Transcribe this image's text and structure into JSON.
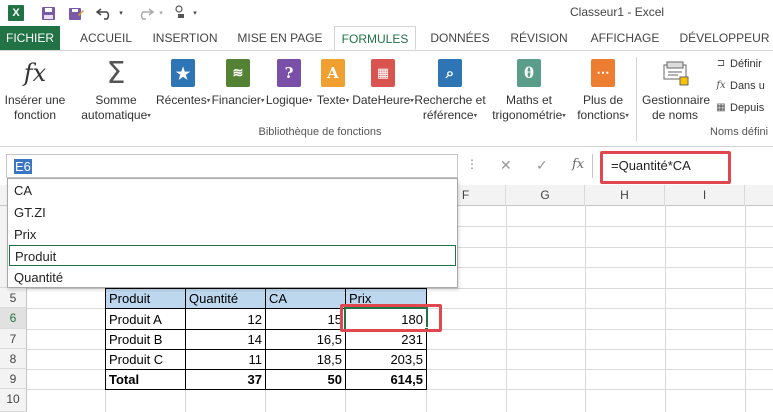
{
  "window": {
    "title": "Classeur1 - Excel"
  },
  "quick_access": {
    "logo_letter": "X"
  },
  "tabs": [
    "FICHIER",
    "ACCUEIL",
    "INSERTION",
    "MISE EN PAGE",
    "FORMULES",
    "DONNÉES",
    "RÉVISION",
    "AFFICHAGE",
    "DÉVELOPPEUR"
  ],
  "active_tab": "FORMULES",
  "ribbon": {
    "insert_function": {
      "line1": "Insérer une",
      "line2": "fonction",
      "icon_text": "fx"
    },
    "autosum": {
      "line1": "Somme",
      "line2": "automatique"
    },
    "recent": {
      "label": "Récentes"
    },
    "financial": {
      "label": "Financier"
    },
    "logical": {
      "label": "Logique",
      "icon_text": "?"
    },
    "text": {
      "label": "Texte",
      "icon_text": "A"
    },
    "datetime": {
      "label": "DateHeure"
    },
    "lookup": {
      "line1": "Recherche et",
      "line2": "référence"
    },
    "math": {
      "line1": "Maths et",
      "line2": "trigonométrie",
      "icon_text": "θ"
    },
    "more": {
      "line1": "Plus de",
      "line2": "fonctions"
    },
    "group_label": "Bibliothèque de fonctions",
    "name_manager": {
      "line1": "Gestionnaire",
      "line2": "de noms"
    },
    "define_name": "Définir",
    "use_in_formula": "Dans u",
    "create_from_selection": "Depuis",
    "group2_label": "Noms défini"
  },
  "formula_bar": {
    "name_box_value": "E6",
    "formula": "=Quantité*CA",
    "fx": "fx"
  },
  "name_dropdown": {
    "items": [
      "CA",
      "GT.ZI",
      "Prix",
      "Produit",
      "Quantité"
    ],
    "selected": "Produit"
  },
  "grid": {
    "column_headers": [
      "F",
      "G",
      "H",
      "I"
    ],
    "row_headers": [
      "5",
      "6",
      "7",
      "8",
      "9",
      "10"
    ],
    "selected_row": "6",
    "table": {
      "headers": [
        "Produit",
        "Quantité",
        "CA",
        "Prix"
      ],
      "rows": [
        [
          "Produit A",
          "12",
          "15",
          "180"
        ],
        [
          "Produit B",
          "14",
          "16,5",
          "231"
        ],
        [
          "Produit C",
          "11",
          "18,5",
          "203,5"
        ]
      ],
      "total": [
        "Total",
        "37",
        "50",
        "614,5"
      ]
    }
  },
  "colors": {
    "excel_green": "#217346",
    "header_fill": "#bdd7ee",
    "highlight_red": "#e0474f",
    "namebox_selection": "#3a76c4"
  }
}
